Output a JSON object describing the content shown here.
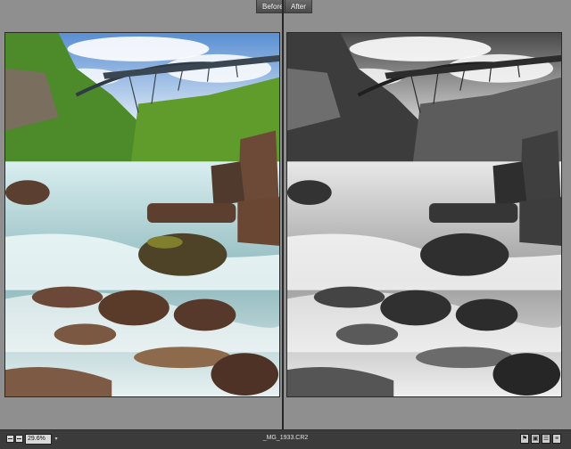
{
  "views": {
    "before_label": "Before",
    "after_label": "After"
  },
  "statusbar": {
    "zoom_value": "29.6%",
    "filename": "_MG_1933.CR2",
    "tools": [
      "flag-icon",
      "compare-icon",
      "settings-icon",
      "workflow-icon"
    ]
  }
}
